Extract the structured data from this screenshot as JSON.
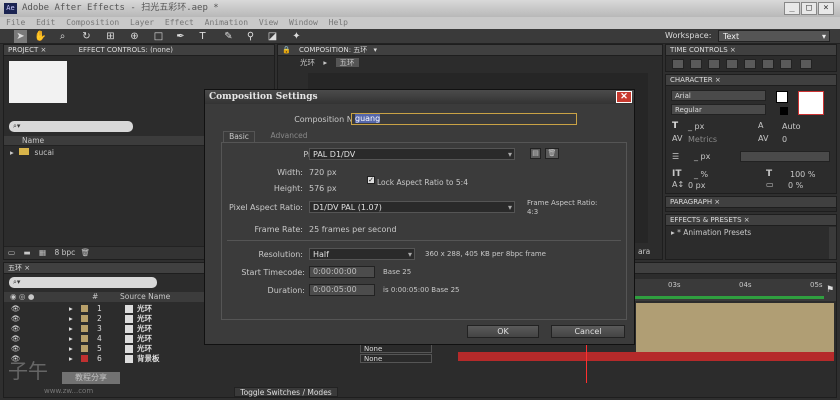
{
  "app": {
    "title": "Adobe After Effects - 扫光五彩环.aep *",
    "logo": "Ae",
    "win_minimize": "_",
    "win_maximize": "□",
    "win_close": "×"
  },
  "menu": [
    "File",
    "Edit",
    "Composition",
    "Layer",
    "Effect",
    "Animation",
    "View",
    "Window",
    "Help"
  ],
  "toolbar": {
    "tools": [
      "selection-tool",
      "hand-tool",
      "zoom-tool",
      "rotate-tool",
      "camera-tool",
      "pan-behind-tool",
      "rectangle-tool",
      "pen-tool",
      "type-tool",
      "brush-tool",
      "clone-stamp-tool",
      "eraser-tool",
      "puppet-tool"
    ],
    "workspace_label": "Workspace:",
    "workspace_value": "Text"
  },
  "project_panel": {
    "tab_project": "PROJECT ×",
    "tab_effect_controls": "EFFECT CONTROLS: (none)",
    "col_name": "Name",
    "item": "sucai",
    "bpc": "8 bpc"
  },
  "composition_panel": {
    "tab": "COMPOSITION: 五环",
    "breadcrumb_1": "光环",
    "breadcrumb_2": "五环",
    "camera_hint": "ara"
  },
  "right_panels": {
    "time_controls": "TIME CONTROLS ×",
    "character": "CHARACTER ×",
    "font": "Arial",
    "style": "Regular",
    "font_size": "_ px",
    "leading": "Auto",
    "kerning": "Metrics",
    "tracking": "0",
    "stroke": "_ px",
    "vscale": "_ %",
    "hscale": "100 %",
    "baseline": "0 px",
    "tsume": "0 %",
    "paragraph": "PARAGRAPH ×",
    "effects_presets": "EFFECTS & PRESETS ×",
    "animation_presets": "* Animation Presets"
  },
  "timeline": {
    "tab": "五环 ×",
    "col_source_name": "Source Name",
    "layers": [
      {
        "num": "1",
        "name": "光环",
        "color": "#b8a06a"
      },
      {
        "num": "2",
        "name": "光环",
        "color": "#b8a06a"
      },
      {
        "num": "3",
        "name": "光环",
        "color": "#b8a06a"
      },
      {
        "num": "4",
        "name": "光环",
        "color": "#b8a06a"
      },
      {
        "num": "5",
        "name": "光环",
        "color": "#b8a06a"
      },
      {
        "num": "6",
        "name": "背景板",
        "color": "#c03030"
      }
    ],
    "parent_none": "None",
    "ruler": [
      "03s",
      "04s",
      "05s"
    ],
    "toggle_label": "Toggle Switches / Modes",
    "watermark_main": "子午",
    "watermark_badge": "教程分享",
    "watermark_url": "www.zw...com"
  },
  "dialog": {
    "title": "Composition Settings",
    "close": "✕",
    "comp_name_label": "Composition Name:",
    "comp_name_value": "guang",
    "tab_basic": "Basic",
    "tab_advanced": "Advanced",
    "preset_label": "Preset:",
    "preset_value": "PAL D1/DV",
    "width_label": "Width:",
    "width_value": "720 px",
    "height_label": "Height:",
    "height_value": "576 px",
    "lock_label": "Lock Aspect Ratio to 5:4",
    "par_label": "Pixel Aspect Ratio:",
    "par_value": "D1/DV PAL (1.07)",
    "far_label": "Frame Aspect Ratio:",
    "far_value": "4:3",
    "frame_rate_label": "Frame Rate:",
    "frame_rate_value": "25 frames per second",
    "resolution_label": "Resolution:",
    "resolution_value": "Half",
    "resolution_info": "360 x 288, 405 KB per 8bpc frame",
    "start_tc_label": "Start Timecode:",
    "start_tc_value": "0:00:00:00",
    "start_tc_base": "Base 25",
    "duration_label": "Duration:",
    "duration_value": "0:00:05:00",
    "duration_info": "is 0:00:05:00  Base 25",
    "ok": "OK",
    "cancel": "Cancel"
  }
}
